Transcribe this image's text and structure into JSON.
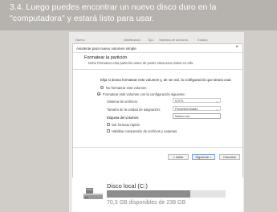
{
  "caption": {
    "line1": "3.4. Luego puedes encontrar un nuevo disco duro en la",
    "line2": "\"computadora\" y estará listo para usar."
  },
  "tabs": [
    "Nuevo",
    "Distribución",
    "Tipo",
    "Sistema de archivos",
    "Estado"
  ],
  "wizard": {
    "title": "Asistente para nuevo volumen simple",
    "close": "×",
    "heading": "Formatear la partición",
    "subheading": "Debe formatear esta partición antes de poder almacenar datos en ella.",
    "question": "Elija si desea formatear este volumen y, de ser así, la configuración que desea usar.",
    "option_no_format": "No formatear este volumen",
    "option_format": "Formatear este volumen con la configuración siguiente:",
    "fields": {
      "filesystem_label": "Sistema de archivos:",
      "filesystem_value": "NTFS",
      "allocation_label": "Tamaño de la unidad de asignación:",
      "allocation_value": "Predeterminado",
      "volume_label_label": "Etiqueta del volumen:",
      "volume_label_value": "Nuevo vol"
    },
    "quick_format": "Dar formato rápido",
    "compression": "Habilitar compresión de archivos y carpetas",
    "buttons": {
      "back": "< Atrás",
      "next": "Siguiente >",
      "cancel": "Cancelar"
    }
  },
  "drive": {
    "name": "Disco local (C:)",
    "space": "70,3 GB disponibles de 238 GB",
    "used_fraction": 0.705,
    "icon": "hard-drive-icon"
  },
  "colors": {
    "caption_bg": "#b6b3ae",
    "usage_bar": "#8d8d8d",
    "primary_border": "#7aa0d8"
  }
}
